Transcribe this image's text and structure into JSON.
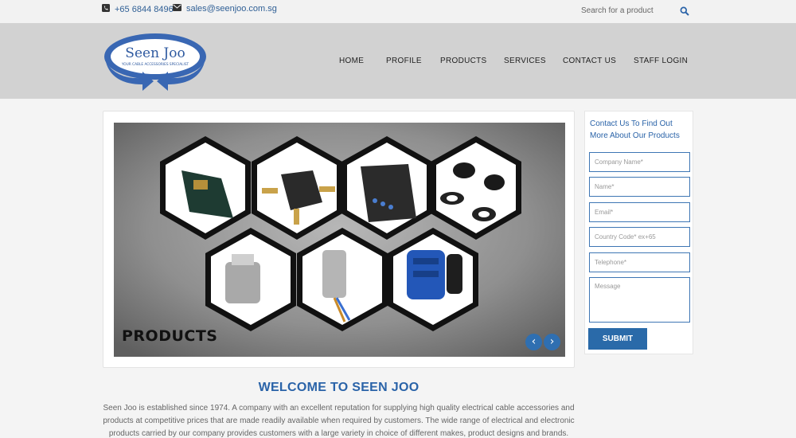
{
  "topbar": {
    "phone": "+65 6844 8496",
    "email": "sales@seenjoo.com.sg",
    "search_placeholder": "Search for a product",
    "phone_icon": "phone-icon",
    "email_icon": "envelope-icon",
    "search_icon": "magnifier-icon"
  },
  "logo": {
    "name": "Seen Joo",
    "tagline": "Your Cable Accessories Specialist"
  },
  "nav": {
    "items": [
      {
        "label": "HOME"
      },
      {
        "label": "PROFILE"
      },
      {
        "label": "PRODUCTS"
      },
      {
        "label": "SERVICES"
      },
      {
        "label": "CONTACT US"
      },
      {
        "label": "STAFF LOGIN"
      }
    ]
  },
  "slider": {
    "caption": "PRODUCTS",
    "prev_label": "‹",
    "next_label": "›"
  },
  "contact_form": {
    "title": "Contact Us To Find Out More About Our Products",
    "company_placeholder": "Company Name*",
    "name_placeholder": "Name*",
    "email_placeholder": "Email*",
    "country_code_placeholder": "Country Code* ex+65",
    "telephone_placeholder": "Telephone*",
    "message_placeholder": "Message",
    "submit_label": "SUBMIT"
  },
  "welcome": {
    "title": "WELCOME TO SEEN JOO",
    "text": "Seen Joo is established since 1974. A company with an excellent reputation for supplying high quality electrical cable accessories and products at competitive prices that are made readily available when required by customers. The wide range of electrical and electronic products carried by our company provides customers with a large variety in choice of different makes, product designs and brands."
  },
  "colors": {
    "brand_blue": "#2a63a8",
    "header_bg": "#d2d2d2",
    "button_blue": "#2a6aa9"
  }
}
